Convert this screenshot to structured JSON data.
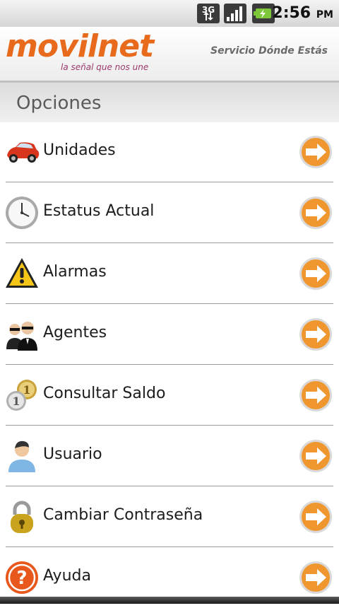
{
  "status_bar": {
    "network": "3G",
    "time": "2:56",
    "ampm": "PM"
  },
  "header": {
    "logo_text": "movilnet",
    "tagline": "la señal que nos une",
    "service_title": "Servicio Dónde Estás"
  },
  "section": {
    "title": "Opciones"
  },
  "menu": {
    "items": [
      {
        "label": "Unidades",
        "icon": "car-icon"
      },
      {
        "label": "Estatus Actual",
        "icon": "clock-icon"
      },
      {
        "label": "Alarmas",
        "icon": "warning-icon"
      },
      {
        "label": "Agentes",
        "icon": "agents-icon"
      },
      {
        "label": "Consultar Saldo",
        "icon": "coins-icon"
      },
      {
        "label": "Usuario",
        "icon": "user-icon"
      },
      {
        "label": "Cambiar Contraseña",
        "icon": "padlock-icon"
      },
      {
        "label": "Ayuda",
        "icon": "help-icon"
      }
    ]
  },
  "colors": {
    "brand_orange": "#e86a1c",
    "arrow_orange": "#f0962e"
  }
}
